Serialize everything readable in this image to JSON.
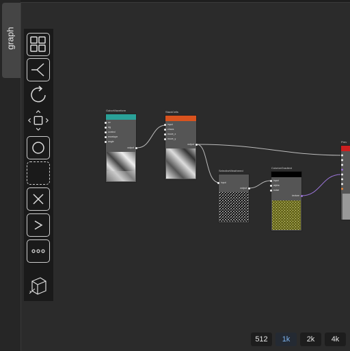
{
  "sidebar": {
    "tab_label": "graph"
  },
  "toolbar": {
    "tools": [
      "grid-view-icon",
      "branch-icon",
      "rotate-icon",
      "move-icon",
      "circle-icon",
      "dashed-square-icon",
      "close-icon",
      "greater-than-icon",
      "more-dots-icon",
      "cube-icon"
    ]
  },
  "nodes": [
    {
      "title": "GaborWaveform",
      "color": "#2aa198",
      "inputs": [
        "uv",
        "dg",
        "control",
        "envelope",
        "angle"
      ],
      "output": "output"
    },
    {
      "title": "StackCells",
      "color": "#d9531e",
      "inputs": [
        "input",
        "chaos",
        "move_x",
        "move_y"
      ],
      "output": "output"
    },
    {
      "title": "SelectiveWeathered",
      "color": "#555555",
      "inputs": [
        "input"
      ],
      "output": "output"
    },
    {
      "title": "ColorizeGradient",
      "color": "#000000",
      "inputs": [
        "input",
        "alpha",
        "noise"
      ],
      "output": "texture"
    },
    {
      "title": "Prev",
      "color": "#cc1f1f",
      "inputs": [],
      "output": ""
    }
  ],
  "resolution": {
    "options": [
      "512",
      "1k",
      "2k",
      "4k"
    ],
    "selected": "1k"
  }
}
